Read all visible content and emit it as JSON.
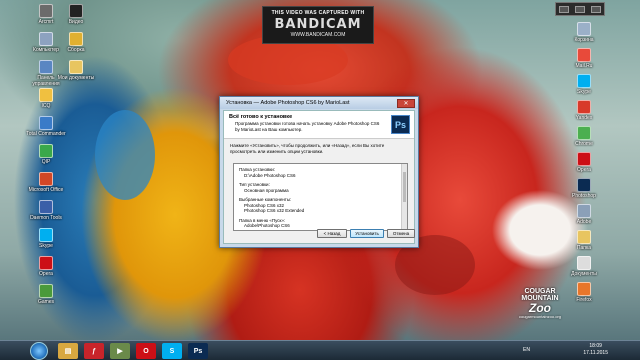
{
  "overlay": {
    "caption": "THIS VIDEO WAS CAPTURED WITH",
    "logo": "BANDICAM",
    "url": "WWW.BANDICAM.COM"
  },
  "desktop_icons_left": [
    {
      "label": "Arcmrt",
      "name": "arcmrt-icon",
      "color": "#6b6b6b"
    },
    {
      "label": "Компьютер",
      "name": "computer-icon",
      "color": "#8da2c0"
    },
    {
      "label": "Панель управления",
      "name": "control-panel-icon",
      "color": "#5a86c2"
    },
    {
      "label": "ICQ",
      "name": "icq-icon",
      "color": "#f0c040"
    },
    {
      "label": "Total Commander",
      "name": "total-commander-icon",
      "color": "#3a7bc8"
    },
    {
      "label": "QIP",
      "name": "qip-icon",
      "color": "#3aa84a"
    },
    {
      "label": "Microsoft Office",
      "name": "office-icon",
      "color": "#d24726"
    },
    {
      "label": "Daemon Tools",
      "name": "daemon-tools-icon",
      "color": "#3a5fa8"
    },
    {
      "label": "Skype",
      "name": "skype-icon",
      "color": "#00aff0"
    },
    {
      "label": "Opera",
      "name": "opera-icon",
      "color": "#cc0f16"
    },
    {
      "label": "Games",
      "name": "games-icon",
      "color": "#4a9a3a"
    }
  ],
  "desktop_icons_col2": [
    {
      "label": "Видео",
      "name": "video-icon",
      "color": "#222222"
    },
    {
      "label": "Сборка",
      "name": "build-icon",
      "color": "#e0b030"
    },
    {
      "label": "Мои документы",
      "name": "documents-icon",
      "color": "#e8c560"
    }
  ],
  "desktop_icons_right": [
    {
      "label": "Корзина",
      "name": "recycle-bin-icon",
      "color": "#9bb0c8"
    },
    {
      "label": "Mail.Ru",
      "name": "mail-icon",
      "color": "#e84a3a"
    },
    {
      "label": "Skype",
      "name": "skype-right-icon",
      "color": "#00aff0"
    },
    {
      "label": "Yandex",
      "name": "yandex-icon",
      "color": "#d83a2a"
    },
    {
      "label": "Chrome",
      "name": "chrome-icon",
      "color": "#4caf50"
    },
    {
      "label": "Opera",
      "name": "opera-right-icon",
      "color": "#cc0f16"
    },
    {
      "label": "Photoshop",
      "name": "photoshop-desktop-icon",
      "color": "#0b2b52"
    },
    {
      "label": "Adobe",
      "name": "adobe-icon",
      "color": "#8ba0b8"
    },
    {
      "label": "Папка",
      "name": "folder-icon",
      "color": "#e8c560"
    },
    {
      "label": "Документы",
      "name": "docs-right-icon",
      "color": "#dddddd"
    },
    {
      "label": "Firefox",
      "name": "firefox-icon",
      "color": "#e8762a"
    }
  ],
  "dialog": {
    "title": "Установка — Adobe Photoshop CS6 by MarioLast",
    "close": "✕",
    "header_title": "Всё готово к установке",
    "header_sub": "Программа установки готова начать установку Adobe Photoshop CS6 by MarioLast на Ваш компьютер.",
    "ps_logo": "Ps",
    "intro": "Нажмите «Установить», чтобы продолжить, или «Назад», если Вы хотите просмотреть или изменить опции установки.",
    "info": {
      "folder_label": "Папка установки:",
      "folder_value": "D:\\Adobe Photoshop CS6",
      "type_label": "Тип установки:",
      "type_value": "Основная программа",
      "components_label": "Выбранные компоненты:",
      "component_1": "Photoshop CS6 x32",
      "component_2": "Photoshop CS6 x32 Extended",
      "menu_label": "Папка в меню «Пуск»:",
      "menu_value": "Adobe\\Photoshop CS6"
    },
    "buttons": {
      "back": "< Назад",
      "install": "Установить",
      "cancel": "Отмена"
    }
  },
  "watermark": {
    "line1": "COUGAR",
    "line2": "MOUNTAIN",
    "line3": "Zoo",
    "site": "cougarmountainzoo.org"
  },
  "taskbar": {
    "items": [
      {
        "name": "explorer-taskbar-icon",
        "glyph": "▤",
        "color": "#d8a840"
      },
      {
        "name": "flash-taskbar-icon",
        "glyph": "ƒ",
        "color": "#c8242a"
      },
      {
        "name": "media-taskbar-icon",
        "glyph": "▶",
        "color": "#6a8a4a"
      },
      {
        "name": "opera-taskbar-icon",
        "glyph": "O",
        "color": "#cc0f16"
      },
      {
        "name": "skype-taskbar-icon",
        "glyph": "S",
        "color": "#00aff0"
      },
      {
        "name": "photoshop-taskbar-icon",
        "glyph": "Ps",
        "color": "#0b2b52"
      }
    ],
    "lang": "EN",
    "time": "18:09",
    "date": "17.11.2015"
  }
}
